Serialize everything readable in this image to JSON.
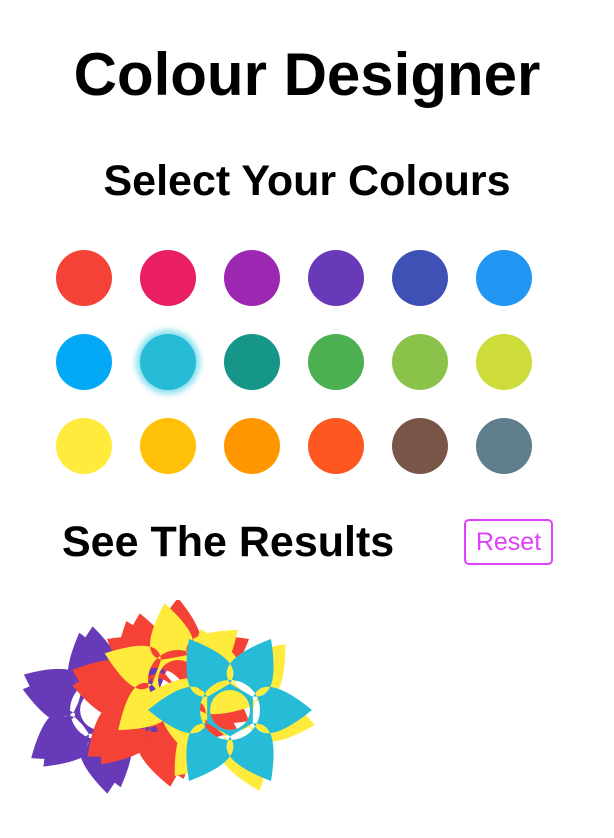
{
  "header": {
    "title": "Colour Designer"
  },
  "palette_section": {
    "title": "Select Your Colours",
    "selected_index": 7,
    "swatches": [
      {
        "color": "#f44336",
        "name": "red"
      },
      {
        "color": "#e91e63",
        "name": "pink"
      },
      {
        "color": "#9c27b0",
        "name": "purple"
      },
      {
        "color": "#673ab7",
        "name": "deep-purple"
      },
      {
        "color": "#3f51b5",
        "name": "indigo"
      },
      {
        "color": "#2196f3",
        "name": "blue"
      },
      {
        "color": "#03a9f4",
        "name": "light-blue"
      },
      {
        "color": "#26bcd7",
        "name": "cyan"
      },
      {
        "color": "#169688",
        "name": "teal"
      },
      {
        "color": "#4caf50",
        "name": "green"
      },
      {
        "color": "#8bc34a",
        "name": "light-green"
      },
      {
        "color": "#cddc39",
        "name": "lime"
      },
      {
        "color": "#ffeb3b",
        "name": "yellow"
      },
      {
        "color": "#ffc107",
        "name": "amber"
      },
      {
        "color": "#ff9800",
        "name": "orange"
      },
      {
        "color": "#ff5722",
        "name": "deep-orange"
      },
      {
        "color": "#795548",
        "name": "brown"
      },
      {
        "color": "#607d8b",
        "name": "blue-grey"
      }
    ]
  },
  "results_section": {
    "title": "See The Results",
    "reset_label": "Reset",
    "flowers": [
      {
        "name": "purple-flower",
        "back_color": "#673ab7",
        "front_color": "#673ab7"
      },
      {
        "name": "red-flower",
        "back_color": "#f44336",
        "front_color": "#f44336"
      },
      {
        "name": "yellow-red-flower",
        "back_color": "#f44336",
        "front_color": "#ffeb3b"
      },
      {
        "name": "cyan-yellow-flower",
        "back_color": "#ffeb3b",
        "front_color": "#26bcd7"
      }
    ]
  }
}
